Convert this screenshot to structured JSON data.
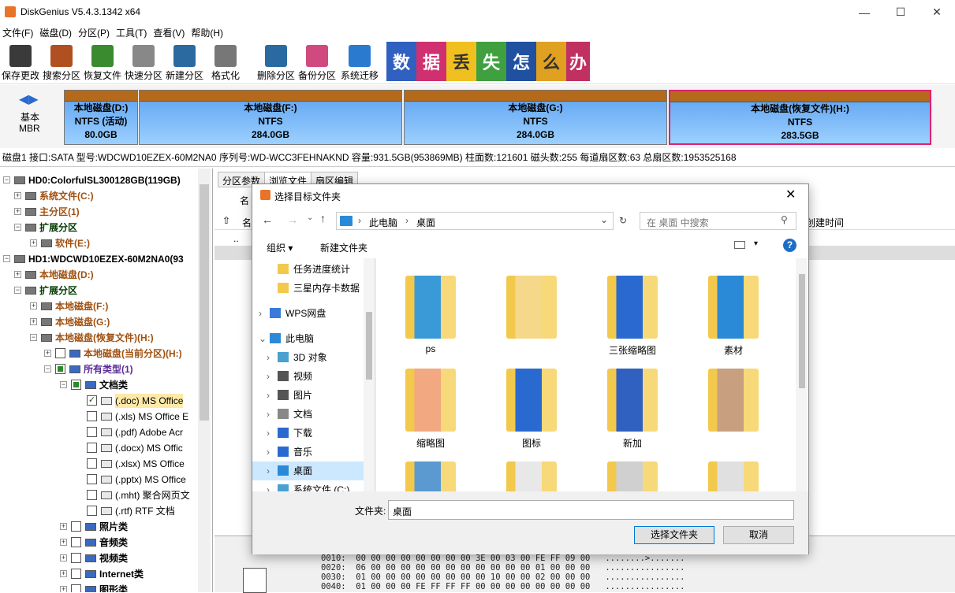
{
  "app": {
    "title": "DiskGenius V5.4.3.1342 x64"
  },
  "menu": [
    "文件(F)",
    "磁盘(D)",
    "分区(P)",
    "工具(T)",
    "查看(V)",
    "帮助(H)"
  ],
  "toolbar": [
    {
      "label": "保存更改",
      "icon": "save-icon",
      "color": "#3a3a3a"
    },
    {
      "label": "搜索分区",
      "icon": "magnifier-icon",
      "color": "#b05020"
    },
    {
      "label": "恢复文件",
      "icon": "recover-icon",
      "color": "#3a8a30"
    },
    {
      "label": "快速分区",
      "icon": "disk-icon",
      "color": "#888888"
    },
    {
      "label": "新建分区",
      "icon": "layers-icon",
      "color": "#2a6aa0"
    },
    {
      "label": "格式化",
      "icon": "gear-icon",
      "color": "#777777"
    },
    {
      "label": "删除分区",
      "icon": "trash-icon",
      "color": "#2a6aa0"
    },
    {
      "label": "备份分区",
      "icon": "pie-icon",
      "color": "#d04a80"
    },
    {
      "label": "系统迁移",
      "icon": "windows-icon",
      "color": "#2a7ad0"
    }
  ],
  "banner": {
    "chars": [
      "数",
      "据",
      "丢",
      "失",
      "怎",
      "么",
      "办",
      "！"
    ]
  },
  "diskmap": {
    "nav_label1": "基本",
    "nav_label2": "MBR",
    "partitions": [
      {
        "name": "本地磁盘(D:)",
        "fs": "NTFS (活动)",
        "size": "80.0GB"
      },
      {
        "name": "本地磁盘(F:)",
        "fs": "NTFS",
        "size": "284.0GB"
      },
      {
        "name": "本地磁盘(G:)",
        "fs": "NTFS",
        "size": "284.0GB"
      },
      {
        "name": "本地磁盘(恢复文件)(H:)",
        "fs": "NTFS",
        "size": "283.5GB"
      }
    ]
  },
  "infobar": "磁盘1 接口:SATA  型号:WDCWD10EZEX-60M2NA0  序列号:WD-WCC3FEHNAKND  容量:931.5GB(953869MB)  柱面数:121601  磁头数:255  每道扇区数:63  总扇区数:1953525168",
  "tree": [
    {
      "label": "HD0:ColorfulSL300128GB(119GB)",
      "cls": "blk",
      "indent": 0
    },
    {
      "label": "系统文件(C:)",
      "cls": "brown",
      "indent": 1
    },
    {
      "label": "主分区(1)",
      "cls": "brown",
      "indent": 1
    },
    {
      "label": "扩展分区",
      "cls": "green",
      "indent": 1
    },
    {
      "label": "软件(E:)",
      "cls": "brown",
      "indent": 2
    },
    {
      "label": "HD1:WDCWD10EZEX-60M2NA0(93",
      "cls": "blk",
      "indent": 0
    },
    {
      "label": "本地磁盘(D:)",
      "cls": "brown",
      "indent": 1
    },
    {
      "label": "扩展分区",
      "cls": "green",
      "indent": 1
    },
    {
      "label": "本地磁盘(F:)",
      "cls": "brown",
      "indent": 2
    },
    {
      "label": "本地磁盘(G:)",
      "cls": "brown",
      "indent": 2
    },
    {
      "label": "本地磁盘(恢复文件)(H:)",
      "cls": "brown",
      "indent": 2
    },
    {
      "label": "本地磁盘(当前分区)(H:)",
      "cls": "brown",
      "indent": 3
    },
    {
      "label": "所有类型(1)",
      "cls": "purple",
      "indent": 3
    },
    {
      "label": "文档类",
      "cls": "blk",
      "indent": 4
    },
    {
      "label": "(.doc) MS Office",
      "cls": "",
      "indent": 5
    },
    {
      "label": "(.xls) MS Office E",
      "cls": "",
      "indent": 5
    },
    {
      "label": "(.pdf) Adobe Acr",
      "cls": "",
      "indent": 5
    },
    {
      "label": "(.docx) MS Offic",
      "cls": "",
      "indent": 5
    },
    {
      "label": "(.xlsx) MS Office",
      "cls": "",
      "indent": 5
    },
    {
      "label": "(.pptx) MS Office",
      "cls": "",
      "indent": 5
    },
    {
      "label": "(.mht) 聚合网页文",
      "cls": "",
      "indent": 5
    },
    {
      "label": "(.rtf) RTF 文档",
      "cls": "",
      "indent": 5
    },
    {
      "label": "照片类",
      "cls": "blk",
      "indent": 4
    },
    {
      "label": "音频类",
      "cls": "blk",
      "indent": 4
    },
    {
      "label": "视频类",
      "cls": "blk",
      "indent": 4
    },
    {
      "label": "Internet类",
      "cls": "blk",
      "indent": 4
    },
    {
      "label": "图形类",
      "cls": "blk",
      "indent": 4
    }
  ],
  "right": {
    "tabs": [
      "分区参数",
      "浏览文件",
      "扇区编辑"
    ],
    "col_name": "名",
    "col_created": "创建时间",
    "up_item": ".."
  },
  "hex": "0010:  00 00 00 00 00 00 00 00 3E 00 03 00 FE FF 09 00   ........>.......\n0020:  06 00 00 00 00 00 00 00 00 00 00 00 01 00 00 00   ................\n0030:  01 00 00 00 00 00 00 00 00 10 00 00 02 00 00 00   ................\n0040:  01 00 00 00 FE FF FF FF 00 00 00 00 00 00 00 00   ................",
  "dialog": {
    "title": "选择目标文件夹",
    "address": [
      "此电脑",
      "桌面"
    ],
    "search_placeholder": "在 桌面 中搜索",
    "organize": "组织",
    "new_folder": "新建文件夹",
    "nav": [
      {
        "label": "任务进度统计",
        "icon": "folder-icon",
        "indent": 1
      },
      {
        "label": "三星内存卡数据",
        "icon": "folder-icon",
        "indent": 1
      },
      {
        "label": "WPS网盘",
        "icon": "cloud-icon",
        "indent": 0
      },
      {
        "label": "此电脑",
        "icon": "pc-icon",
        "indent": 0
      },
      {
        "label": "3D 对象",
        "icon": "cube-icon",
        "indent": 1
      },
      {
        "label": "视频",
        "icon": "video-icon",
        "indent": 1
      },
      {
        "label": "图片",
        "icon": "picture-icon",
        "indent": 1
      },
      {
        "label": "文档",
        "icon": "document-icon",
        "indent": 1
      },
      {
        "label": "下载",
        "icon": "download-icon",
        "indent": 1
      },
      {
        "label": "音乐",
        "icon": "music-icon",
        "indent": 1
      },
      {
        "label": "桌面",
        "icon": "desktop-icon",
        "indent": 1
      },
      {
        "label": "系统文件 (C:)",
        "icon": "drive-icon",
        "indent": 1
      }
    ],
    "folders": [
      "ps",
      "",
      "三张缩略图",
      "素材",
      "缩略图",
      "图标",
      "新加",
      "",
      "",
      "",
      "",
      ""
    ],
    "folder_label": "文件夹:",
    "folder_value": "桌面",
    "ok": "选择文件夹",
    "cancel": "取消"
  }
}
